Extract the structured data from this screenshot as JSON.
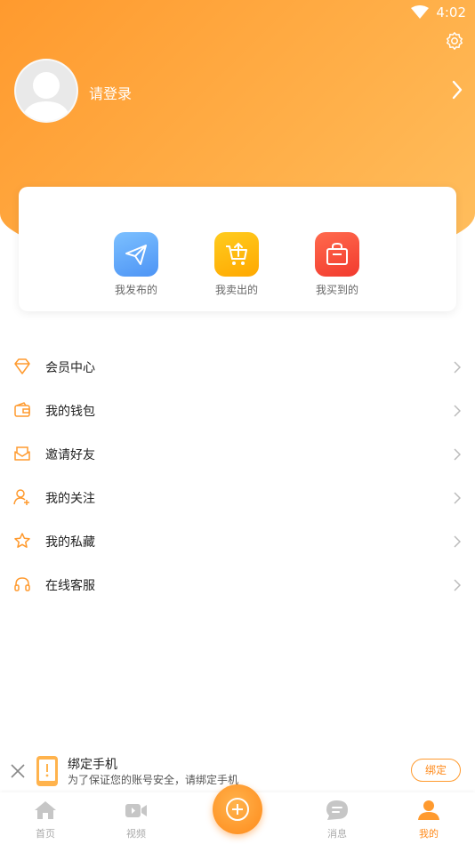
{
  "status_bar": {
    "time": "4:02"
  },
  "colors": {
    "accent": "#ff9a2e",
    "accent_dark": "#ff8a1a",
    "text": "#222222"
  },
  "profile": {
    "login_text": "请登录"
  },
  "orders": [
    {
      "label": "我发布的",
      "icon": "paper-plane-icon",
      "color": "#5aa8ff"
    },
    {
      "label": "我卖出的",
      "icon": "cart-upload-icon",
      "color": "#ffb300"
    },
    {
      "label": "我买到的",
      "icon": "shopping-bag-icon",
      "color": "#ff4d3a"
    }
  ],
  "menu": [
    {
      "label": "会员中心",
      "icon": "diamond-icon"
    },
    {
      "label": "我的钱包",
      "icon": "wallet-icon"
    },
    {
      "label": "邀请好友",
      "icon": "envelope-icon"
    },
    {
      "label": "我的关注",
      "icon": "user-plus-icon"
    },
    {
      "label": "我的私藏",
      "icon": "star-icon"
    },
    {
      "label": "在线客服",
      "icon": "headset-icon"
    }
  ],
  "bind_phone": {
    "title": "绑定手机",
    "subtitle": "为了保证您的账号安全，请绑定手机",
    "button": "绑定"
  },
  "tabs": [
    {
      "label": "首页",
      "icon": "home-icon"
    },
    {
      "label": "视频",
      "icon": "video-icon"
    },
    {
      "label": "",
      "icon": "plus-icon"
    },
    {
      "label": "消息",
      "icon": "message-icon"
    },
    {
      "label": "我的",
      "icon": "person-icon",
      "active": true
    }
  ]
}
